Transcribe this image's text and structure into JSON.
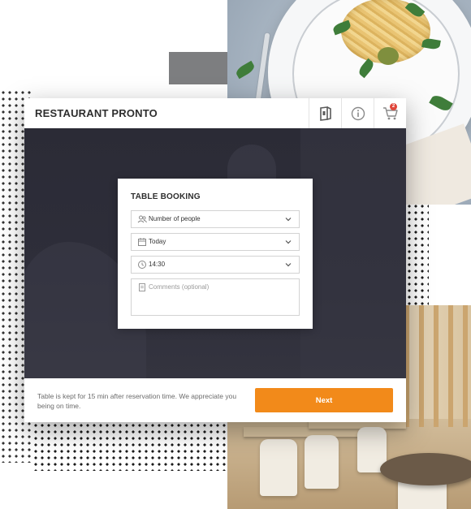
{
  "app": {
    "title": "RESTAURANT PRONTO"
  },
  "toolbar": {
    "icons": [
      "menu-book-icon",
      "info-icon",
      "cart-icon"
    ],
    "cart_count": "2"
  },
  "booking": {
    "title": "TABLE BOOKING",
    "people": {
      "value": "Number of people",
      "icon": "people-icon"
    },
    "date": {
      "value": "Today",
      "icon": "calendar-icon"
    },
    "time": {
      "value": "14:30",
      "icon": "clock-icon"
    },
    "comments": {
      "placeholder": "Comments (optional)",
      "icon": "note-icon"
    }
  },
  "footer": {
    "notice": "Table is kept for 15 min after reservation time. We appreciate you being on time.",
    "next_label": "Next"
  },
  "colors": {
    "accent": "#f28a1a",
    "hero_bg": "#2e2e3a",
    "badge": "#e0463a"
  }
}
